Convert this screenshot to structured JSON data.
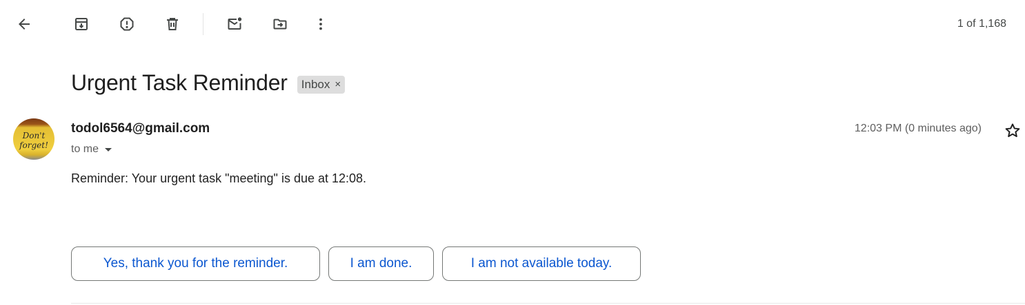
{
  "toolbar": {
    "back": "back-arrow-icon",
    "archive": "archive-icon",
    "report_spam": "report-spam-icon",
    "delete": "delete-icon",
    "mark_unread": "mark-unread-icon",
    "move_to": "move-to-icon",
    "more": "more-vert-icon",
    "count": "1 of 1,168"
  },
  "message": {
    "subject": "Urgent Task Reminder",
    "label": "Inbox",
    "label_remove": "×",
    "sender_email": "todol6564@gmail.com",
    "recipient": "to me",
    "time": "12:03 PM (0 minutes ago)",
    "body": "Reminder: Your urgent task \"meeting\" is due at 12:08."
  },
  "avatar": {
    "line1": "Don't",
    "line2": "forget!"
  },
  "smart_replies": [
    "Yes, thank you for the reminder.",
    "I am done.",
    "I am not available today."
  ],
  "colors": {
    "accent": "#0b57d0",
    "icon": "#444746",
    "chip_bg": "#dddddd"
  }
}
